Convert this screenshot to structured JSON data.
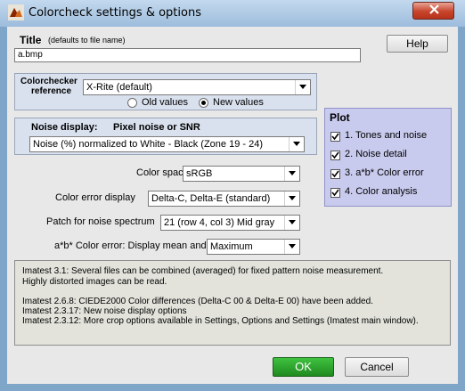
{
  "window": {
    "title": "Colorcheck settings & options",
    "icon": "matlab-icon"
  },
  "title_section": {
    "label": "Title",
    "hint": "(defaults to file name)",
    "value": "a.bmp"
  },
  "help_button": "Help",
  "colorchecker": {
    "label_line1": "Colorchecker",
    "label_line2": "reference",
    "selected": "X-Rite (default)",
    "radio_old": "Old values",
    "radio_new": "New values",
    "selected_radio": "new"
  },
  "noise": {
    "label": "Noise display:",
    "label2": "Pixel noise or SNR",
    "selected": "Noise (%) normalized to White - Black (Zone 19 - 24)"
  },
  "fields": {
    "color_space_label": "Color space",
    "color_space_value": "sRGB",
    "color_error_label": "Color error display",
    "color_error_value": "Delta-C, Delta-E (standard)",
    "patch_label": "Patch for noise spectrum",
    "patch_value": "21  (row 4, col 3)  Mid gray",
    "ab_label": "a*b* Color error:  Display mean and",
    "ab_value": "Maximum"
  },
  "plot": {
    "title": "Plot",
    "items": [
      {
        "label": "1. Tones and noise",
        "checked": true
      },
      {
        "label": "2. Noise detail",
        "checked": true
      },
      {
        "label": "3. a*b* Color error",
        "checked": true
      },
      {
        "label": "4. Color analysis",
        "checked": true
      }
    ]
  },
  "messages": [
    "Imatest 3.1:  Several files can be combined (averaged) for fixed pattern noise measurement.",
    "Highly distorted images can be read.",
    "Imatest 2.6.8:   CIEDE2000 Color differences (Delta-C 00 & Delta-E 00) have been added.",
    "Imatest 2.3.17: New noise display options",
    "Imatest 2.3.12: More crop options available in Settings, Options and Settings (Imatest main window)."
  ],
  "ok_button": "OK",
  "cancel_button": "Cancel",
  "colors": {
    "ok_green": "#2e9e2e",
    "plot_panel": "#c9cbee",
    "panel": "#d9e1ee"
  }
}
